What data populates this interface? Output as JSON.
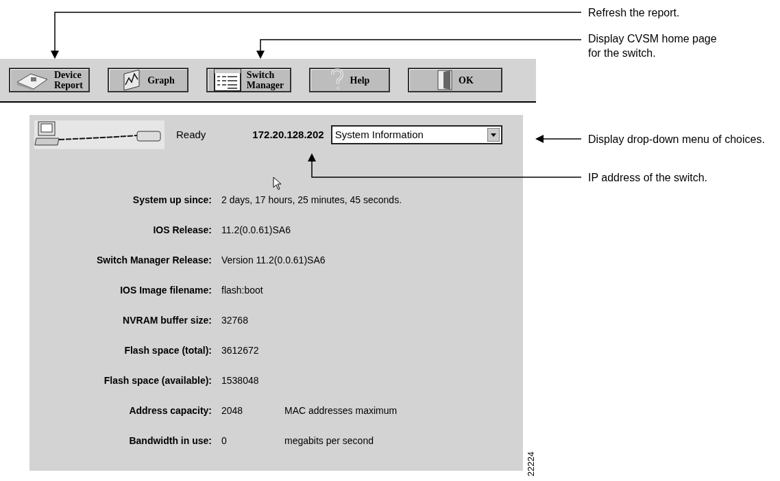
{
  "callouts": [
    {
      "text": "Refresh the report."
    },
    {
      "text": "Display CVSM home page for the switch."
    },
    {
      "text": "Display drop-down menu of choices."
    },
    {
      "text": "IP address of the switch."
    }
  ],
  "toolbar": {
    "buttons": [
      {
        "kind": "report",
        "lines": [
          "Device",
          "Report"
        ]
      },
      {
        "kind": "graph",
        "lines": [
          "Graph"
        ]
      },
      {
        "kind": "manager",
        "lines": [
          "Switch",
          "Manager"
        ]
      },
      {
        "kind": "help",
        "lines": [
          "Help"
        ]
      },
      {
        "kind": "ok",
        "lines": [
          "OK"
        ]
      }
    ]
  },
  "panel": {
    "status": "Ready",
    "ip_address": "172.20.128.202",
    "view_select": {
      "value": "System Information"
    },
    "rows": [
      {
        "label": "System up since:",
        "value": "2 days, 17 hours, 25 minutes, 45 seconds."
      },
      {
        "label": "IOS Release:",
        "value": "11.2(0.0.61)SA6"
      },
      {
        "label": "Switch Manager Release:",
        "value": "Version 11.2(0.0.61)SA6"
      },
      {
        "label": "IOS Image filename:",
        "value": "flash:boot"
      },
      {
        "label": "NVRAM buffer size:",
        "value": "32768"
      },
      {
        "label": "Flash space (total):",
        "value": "3612672"
      },
      {
        "label": "Flash space (available):",
        "value": "1538048"
      },
      {
        "label": "Address capacity:",
        "value": "2048",
        "unit": "MAC addresses maximum"
      },
      {
        "label": "Bandwidth in use:",
        "value": "0",
        "unit": "megabits per second"
      }
    ]
  },
  "figure_number": "22224"
}
